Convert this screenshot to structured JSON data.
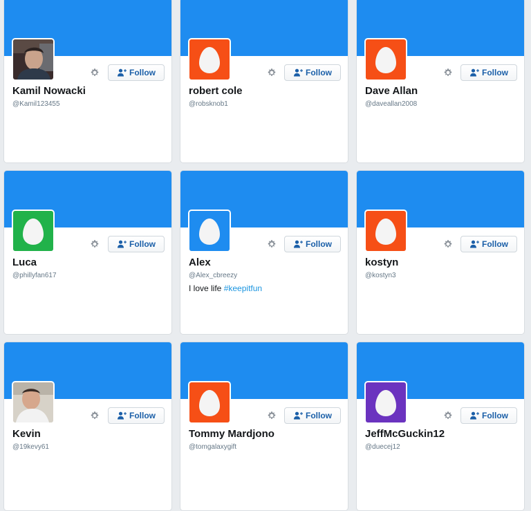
{
  "colors": {
    "banner": "#1e8cf0",
    "egg_orange": "#f64f16",
    "egg_green": "#21b24a",
    "egg_blue": "#1e8cf0",
    "egg_purple": "#6b33bf",
    "link": "#1b95e0"
  },
  "follow_label": "Follow",
  "cards": [
    {
      "name": "Kamil Nowacki",
      "handle": "@Kamil123455",
      "avatar": "photo-man-dark",
      "bio": "",
      "hashtag": ""
    },
    {
      "name": "robert cole",
      "handle": "@robsknob1",
      "avatar": "egg-orange",
      "bio": "",
      "hashtag": ""
    },
    {
      "name": "Dave Allan",
      "handle": "@daveallan2008",
      "avatar": "egg-orange",
      "bio": "",
      "hashtag": ""
    },
    {
      "name": "Luca",
      "handle": "@phillyfan617",
      "avatar": "egg-green",
      "bio": "",
      "hashtag": ""
    },
    {
      "name": "Alex",
      "handle": "@Alex_cbreezy",
      "avatar": "egg-blue",
      "bio": "I love life ",
      "hashtag": "#keepitfun"
    },
    {
      "name": "kostyn",
      "handle": "@kostyn3",
      "avatar": "egg-orange",
      "bio": "",
      "hashtag": ""
    },
    {
      "name": "Kevin",
      "handle": "@19kevy61",
      "avatar": "photo-man-light",
      "bio": "",
      "hashtag": ""
    },
    {
      "name": "Tommy Mardjono",
      "handle": "@tomgalaxygift",
      "avatar": "egg-orange",
      "bio": "",
      "hashtag": ""
    },
    {
      "name": "JeffMcGuckin12",
      "handle": "@duecej12",
      "avatar": "egg-purple",
      "bio": "",
      "hashtag": ""
    }
  ]
}
